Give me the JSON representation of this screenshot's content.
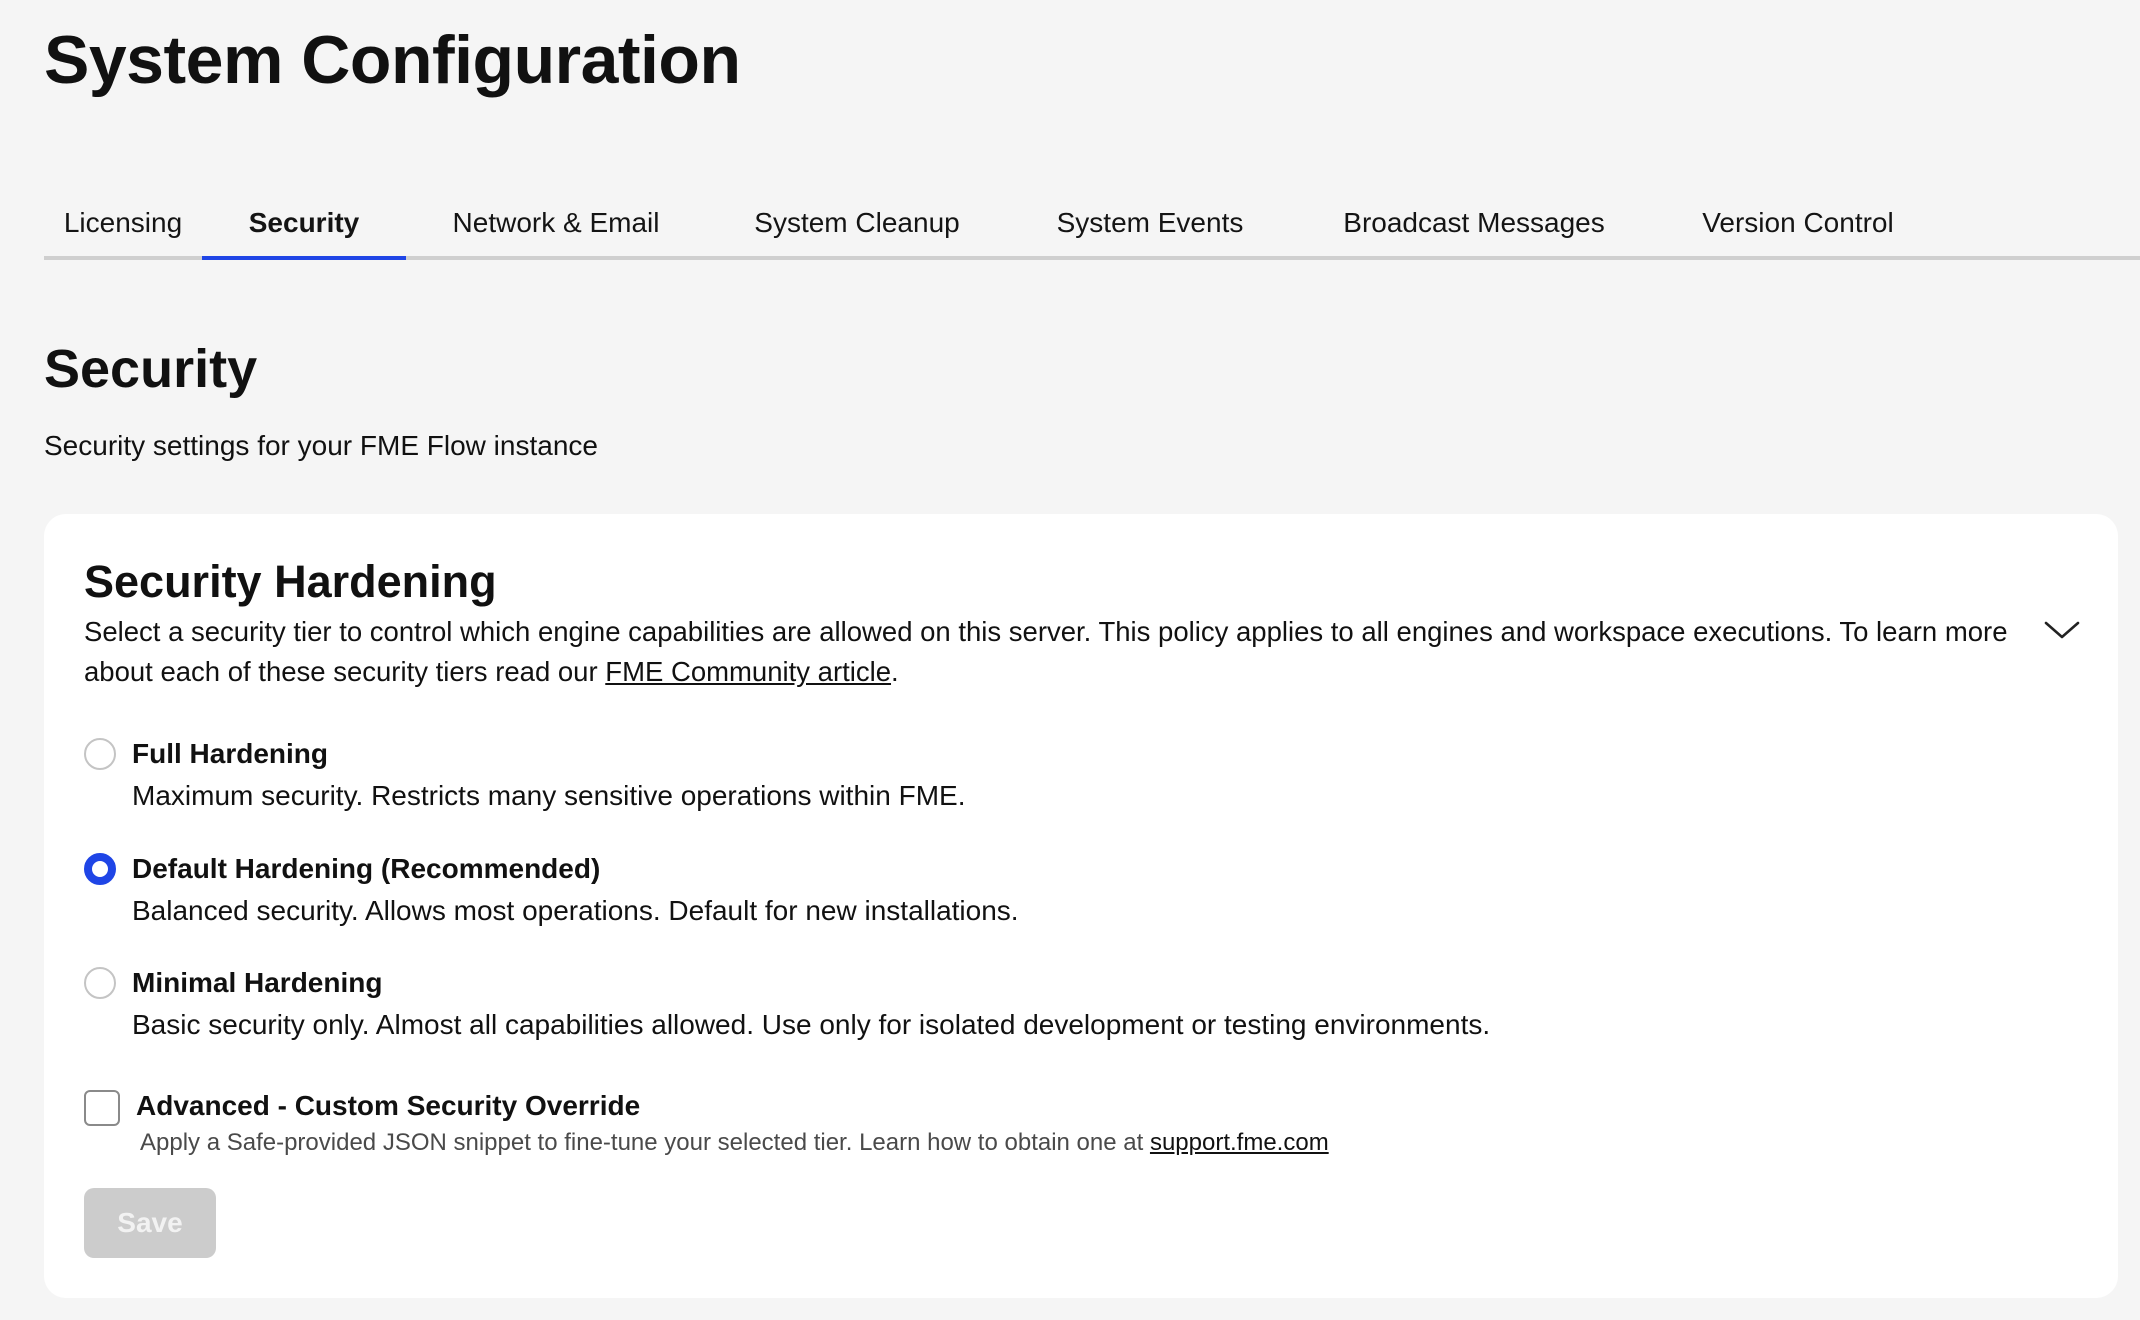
{
  "page": {
    "title": "System Configuration"
  },
  "tabs": [
    {
      "label": "Licensing",
      "active": false
    },
    {
      "label": "Security",
      "active": true
    },
    {
      "label": "Network & Email",
      "active": false
    },
    {
      "label": "System Cleanup",
      "active": false
    },
    {
      "label": "System Events",
      "active": false
    },
    {
      "label": "Broadcast Messages",
      "active": false
    },
    {
      "label": "Version Control",
      "active": false
    }
  ],
  "section": {
    "title": "Security",
    "subtitle": "Security settings for your FME Flow instance"
  },
  "card": {
    "title": "Security Hardening",
    "description_before": "Select a security tier to control which engine capabilities are allowed on this server. This policy applies to all engines and workspace executions. To learn more about each of these security tiers read our ",
    "description_link": "FME Community article",
    "description_after": ".",
    "collapse_icon": "chevron-down-icon",
    "options": [
      {
        "label": "Full Hardening",
        "description": "Maximum security. Restricts many sensitive operations within FME.",
        "selected": false
      },
      {
        "label": "Default Hardening (Recommended)",
        "description": "Balanced security. Allows most operations. Default for new installations.",
        "selected": true
      },
      {
        "label": "Minimal Hardening",
        "description": "Basic security only. Almost all capabilities allowed. Use only for isolated development or testing environments.",
        "selected": false
      }
    ],
    "override": {
      "label": "Advanced - Custom Security Override",
      "checked": false,
      "hint_text": "Apply a Safe-provided JSON snippet to fine-tune your selected tier. Learn how to obtain one at ",
      "hint_link": "support.fme.com"
    },
    "save_label": "Save"
  },
  "colors": {
    "accent": "#1f45e6",
    "background": "#f5f5f5",
    "card": "#ffffff",
    "disabled_button": "#cccccc"
  }
}
